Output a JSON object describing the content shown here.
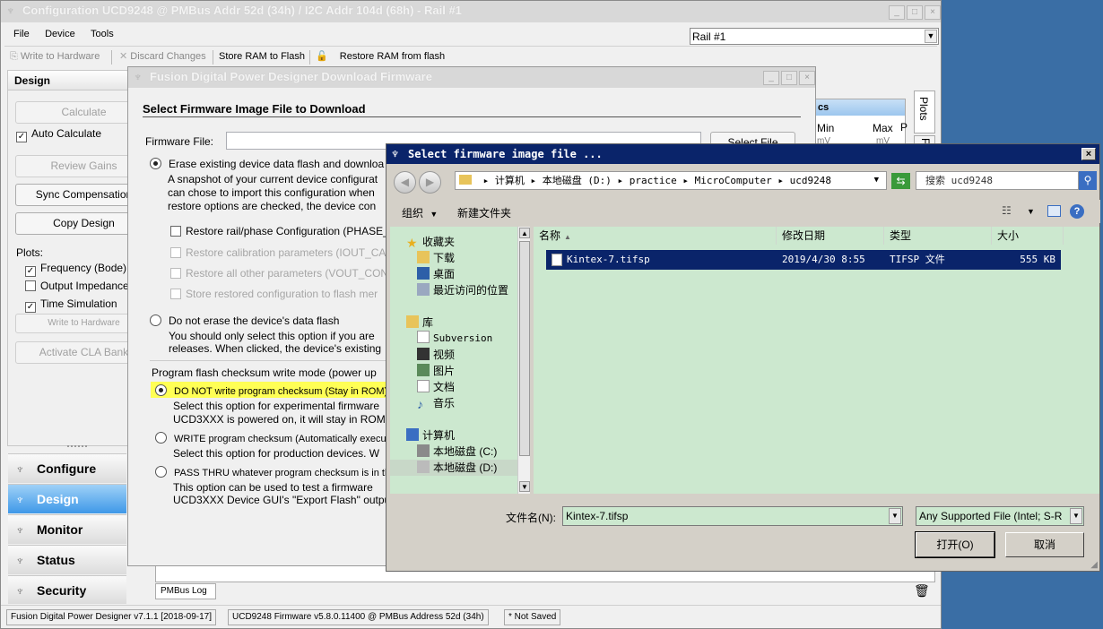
{
  "main": {
    "title": "Configuration UCD9248 @ PMBus Addr 52d (34h) / I2C Addr 104d (68h) - Rail #1",
    "menu": [
      "File",
      "Device",
      "Tools"
    ],
    "rail_select": "Rail #1",
    "toolbar": {
      "write": "Write to Hardware",
      "discard": "Discard Changes",
      "store": "Store RAM to Flash",
      "restore": "Restore RAM from flash"
    },
    "design_header": "Design",
    "buttons": {
      "calculate": "Calculate",
      "review_gains": "Review Gains",
      "sync_comp": "Sync Compensation",
      "copy_design": "Copy Design",
      "write_hw": "Write to Hardware",
      "activate_cla": "Activate CLA Bank"
    },
    "auto_calc": "Auto Calculate",
    "plots_label": "Plots:",
    "plots": [
      "Frequency (Bode)",
      "Output Impedance",
      "Time Simulation"
    ],
    "plots_checked": [
      true,
      false,
      true
    ],
    "nav": [
      "Configure",
      "Design",
      "Monitor",
      "Status",
      "Security"
    ],
    "right_tabs": [
      "Plots",
      "F"
    ],
    "bg_panel": {
      "tab": "cs",
      "min": "Min",
      "max": "Max",
      "p": "P",
      "unit1": "mV",
      "unit2": "mV"
    },
    "pmbus_log": "PMBus Log",
    "status": {
      "app": "Fusion Digital Power Designer v7.1.1 [2018-09-17]",
      "firmware": "UCD9248 Firmware v5.8.0.11400 @ PMBus Address 52d (34h)",
      "saved": "* Not Saved"
    }
  },
  "download": {
    "title": "Fusion Digital Power Designer Download Firmware",
    "heading": "Select Firmware Image File to Download",
    "file_label": "Firmware File:",
    "select_file": "Select File",
    "erase": {
      "label": "Erase existing device data flash and downloa",
      "desc": [
        "A snapshot of your current device configurat",
        "can chose to import this configuration when",
        "restore options are checked, the device con"
      ],
      "options": [
        "Restore rail/phase Configuration (PHASE_",
        "Restore calibration parameters (IOUT_CA",
        "Restore all other parameters (VOUT_CON",
        "Store restored configuration to flash mer"
      ]
    },
    "no_erase": {
      "label": "Do not erase the device's data flash",
      "desc": [
        "You should only select this option if you are",
        "releases. When clicked, the device's existing"
      ]
    },
    "checksum_title": "Program flash checksum write mode (power up",
    "checksum": [
      {
        "label": "DO NOT write program checksum (Stay in ROM)",
        "desc": [
          "Select this option for experimental firmware",
          "UCD3XXX is powered on, it will stay in ROM"
        ]
      },
      {
        "label": "WRITE program checksum (Automatically execute",
        "desc": [
          "Select this option for production devices. W"
        ]
      },
      {
        "label": "PASS THRU whatever program checksum is in the",
        "desc": [
          "This option can be used to test a firmware",
          "UCD3XXX Device GUI's \"Export Flash\" outpu"
        ]
      }
    ]
  },
  "filedlg": {
    "title": "Select firmware image file ...",
    "breadcrumb": [
      "计算机",
      "本地磁盘 (D:)",
      "practice",
      "MicroComputer",
      "ucd9248"
    ],
    "search_placeholder": "搜索 ucd9248",
    "organize": "组织",
    "new_folder": "新建文件夹",
    "favorites": {
      "header": "收藏夹",
      "items": [
        "下载",
        "桌面",
        "最近访问的位置"
      ]
    },
    "libraries": {
      "header": "库",
      "items": [
        "Subversion",
        "视频",
        "图片",
        "文档",
        "音乐"
      ]
    },
    "computer": {
      "header": "计算机",
      "items": [
        "本地磁盘 (C:)",
        "本地磁盘 (D:)"
      ]
    },
    "columns": [
      "名称",
      "修改日期",
      "类型",
      "大小"
    ],
    "files": [
      {
        "name": "Kintex-7.tifsp",
        "date": "2019/4/30 8:55",
        "type": "TIFSP 文件",
        "size": "555 KB"
      }
    ],
    "filename_label": "文件名(N):",
    "filename_value": "Kintex-7.tifsp",
    "filetype": "Any Supported File (Intel; S-R",
    "open": "打开(O)",
    "cancel": "取消"
  }
}
